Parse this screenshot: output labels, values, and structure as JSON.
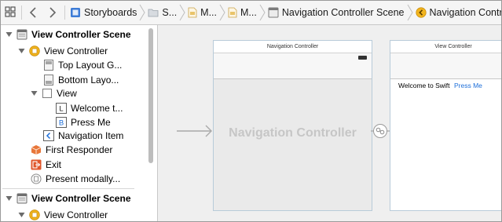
{
  "jumpbar": {
    "crumbs": [
      "Storyboards",
      "S...",
      "M...",
      "M...",
      "Navigation Controller Scene",
      "Navigation Controller"
    ]
  },
  "outline": {
    "scene1": {
      "title": "View Controller Scene",
      "view_controller": "View Controller",
      "top_layout_guide": "Top Layout G...",
      "bottom_layout_guide": "Bottom Layo...",
      "view": "View",
      "label_item": "Welcome t...",
      "button_item": "Press Me",
      "navigation_item": "Navigation Item",
      "first_responder": "First Responder",
      "exit": "Exit",
      "segue": "Present modally..."
    },
    "scene2": {
      "title": "View Controller Scene",
      "view_controller": "View Controller"
    },
    "badges": {
      "label": "L",
      "button": "B"
    }
  },
  "canvas": {
    "nav_controller": {
      "title": "Navigation Controller",
      "watermark": "Navigation Controller"
    },
    "view_controller": {
      "title": "View Controller",
      "label": "Welcome to Swift",
      "button": "Press Me"
    }
  },
  "colors": {
    "accent": "#1e6fd9",
    "vc_icon": "#f2b51f",
    "responder_icon": "#e8773a",
    "exit_icon": "#e0572c"
  }
}
